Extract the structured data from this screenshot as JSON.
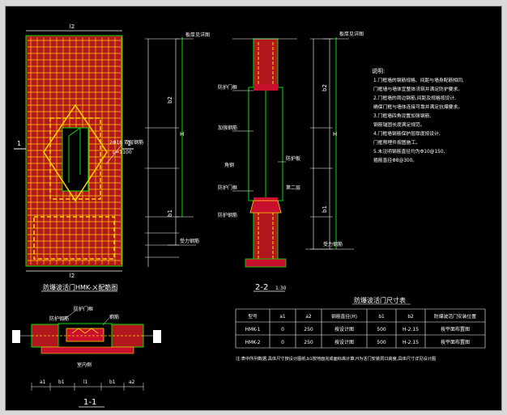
{
  "colors": {
    "background": "#000000",
    "wall": "#c8102e",
    "rebar": "#ffea00",
    "dim": "#ffffff",
    "accent_green": "#00e000",
    "dashed": "#ffd400",
    "cyan": "#00c8ff"
  },
  "plan": {
    "title": "防爆波活门HMK-ㄨ配筋图",
    "dim_top": "l2",
    "dim_bottom": "l2",
    "rebar_note_1": "2Φ16 双层钢筋",
    "rebar_note_2": "L=1100",
    "section_mark": "1",
    "right_dims": [
      "b2",
      "H",
      "b1"
    ],
    "top_note": "板厚见详图",
    "bottom_note": "受力钢筋"
  },
  "section_22": {
    "title": "2-2",
    "scale": "1:30",
    "labels_left": [
      "防护门框",
      "加强钢筋",
      "角钢",
      "防护门框",
      "防护钢筋"
    ],
    "labels_right": [
      "防护板",
      "第二层"
    ],
    "bottom_note": "受力钢筋",
    "right_dims": [
      "b2",
      "H",
      "b1"
    ],
    "top_note": "板厚见详图"
  },
  "section_11": {
    "title": "1-1",
    "labels": [
      "防护门框",
      "防护钢筋",
      "钢筋",
      "室内侧"
    ],
    "dims": [
      "a1",
      "b1",
      "l1",
      "b1",
      "a2"
    ]
  },
  "notes": {
    "heading": "说明:",
    "items": [
      "1.门框墙的钢筋规格、间距与墙身配筋相同,",
      "  门框墙与墙体宜整体浇筑并满足防护要求。",
      "2.门框墙的周边钢筋,间距及规格按设计,",
      "  确保门框与墙体连接可靠并满足抗爆要求。",
      "3.门框墙四角设置加强钢筋,",
      "  钢筋锚固长度满足规范。",
      "4.门框墙钢筋保护层厚度按设计,",
      "  门框预埋件按图施工。",
      "5.未注明钢筋直径均为Φ10@150,",
      "  箍筋直径Φ8@300。"
    ]
  },
  "table": {
    "title": "防爆波活门尺寸表",
    "headers": [
      "型号",
      "a1",
      "a2",
      "钢筋直径(H)",
      "b1",
      "b2",
      "防爆波活门安装位置"
    ],
    "rows": [
      [
        "HMK-1",
        "0",
        "250",
        "按设计图",
        "500",
        "H-2.15",
        "按平面布置图"
      ],
      [
        "HMK-2",
        "0",
        "250",
        "按设计图",
        "500",
        "H-2.15",
        "按平面布置图"
      ]
    ],
    "footnote": "注:表中所列数据,具体尺寸按设计图纸,b1按地面完成面标高计算,H为活门安装洞口高度,具体尺寸详见设计图"
  }
}
